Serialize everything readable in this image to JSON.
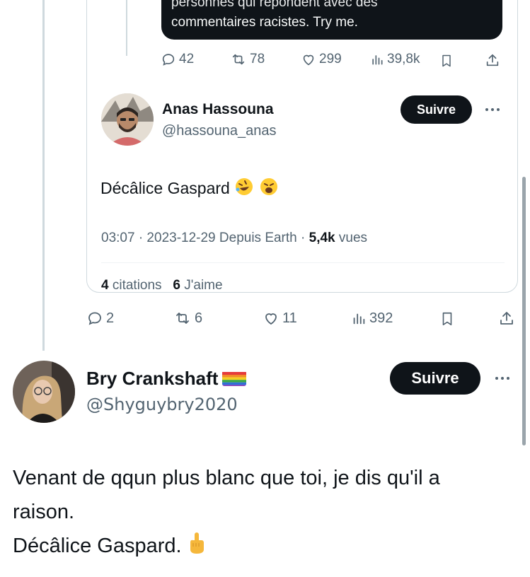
{
  "quoted_parent": {
    "text_line1_cut": "personnes qui répondent avec des",
    "text_line2": "commentaires racistes. Try me.",
    "actions": {
      "replies": "42",
      "reposts": "78",
      "likes": "299",
      "views": "39,8k"
    }
  },
  "quoted_tweet": {
    "author_name": "Anas Hassouna",
    "author_handle": "@hassouna_anas",
    "follow_label": "Suivre",
    "text": "Décâlice Gaspard",
    "time": "03:07 · 2023-12-29 Depuis Earth · ",
    "views_count": "5,4k",
    "views_label": " vues",
    "quotes_count": "4",
    "quotes_label": " citations",
    "likes_count": "6",
    "likes_label": " J'aime"
  },
  "quoted_actions": {
    "replies": "2",
    "reposts": "6",
    "likes": "11",
    "views": "392"
  },
  "reply_tweet": {
    "author_name": "Bry Crankshaft",
    "author_handle": "@Shyguybry2020",
    "follow_label": "Suivre",
    "text_line1": "Venant de qqun plus blanc que toi, je dis qu'il a",
    "text_line2": "raison.",
    "text_line3": "Décâlice Gaspard."
  },
  "icons": [
    "reply-icon",
    "repost-icon",
    "like-icon",
    "views-icon",
    "bookmark-icon",
    "share-icon",
    "more-icon"
  ],
  "colors": {
    "text": "#0f1419",
    "secondary": "#536471",
    "border": "#cfd9de",
    "button": "#0f1419"
  }
}
